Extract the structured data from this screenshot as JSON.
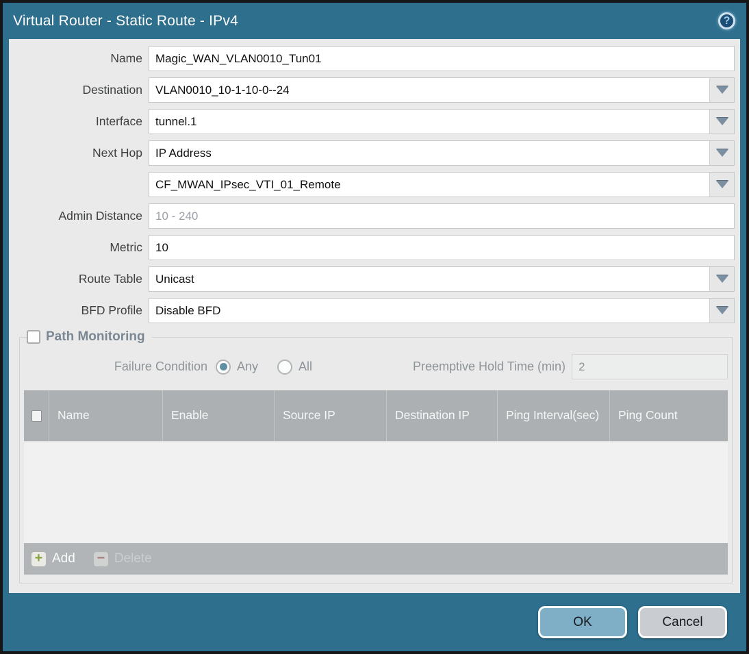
{
  "window": {
    "title": "Virtual Router - Static Route - IPv4",
    "help_icon": "?"
  },
  "form": {
    "name": {
      "label": "Name",
      "value": "Magic_WAN_VLAN0010_Tun01"
    },
    "destination": {
      "label": "Destination",
      "value": "VLAN0010_10-1-10-0--24"
    },
    "interface": {
      "label": "Interface",
      "value": "tunnel.1"
    },
    "next_hop": {
      "label": "Next Hop",
      "value": "IP Address"
    },
    "next_hop_ip": {
      "value": "CF_MWAN_IPsec_VTI_01_Remote"
    },
    "admin_distance": {
      "label": "Admin Distance",
      "value": "",
      "placeholder": "10 - 240"
    },
    "metric": {
      "label": "Metric",
      "value": "10"
    },
    "route_table": {
      "label": "Route Table",
      "value": "Unicast"
    },
    "bfd_profile": {
      "label": "BFD Profile",
      "value": "Disable BFD"
    }
  },
  "path_monitoring": {
    "title": "Path Monitoring",
    "checked": false,
    "failure_condition": {
      "label": "Failure Condition",
      "options": [
        "Any",
        "All"
      ],
      "selected": "Any"
    },
    "preemptive_hold_time": {
      "label": "Preemptive Hold Time (min)",
      "value": "2"
    },
    "table": {
      "columns": [
        "Name",
        "Enable",
        "Source IP",
        "Destination IP",
        "Ping Interval(sec)",
        "Ping Count"
      ],
      "rows": []
    },
    "toolbar": {
      "add_label": "Add",
      "delete_label": "Delete"
    }
  },
  "footer": {
    "ok_label": "OK",
    "cancel_label": "Cancel"
  },
  "colors": {
    "titlebar": "#2E6F8E",
    "content_bg": "#E9EAE9",
    "table_header_bg": "#ACB0B3",
    "ok_button": "#7FAFC7",
    "cancel_button": "#C9CDD1",
    "add_icon_green": "#8AA23B",
    "delete_icon_red": "#9E4F45",
    "radio_selected": "#5E8FA3"
  }
}
